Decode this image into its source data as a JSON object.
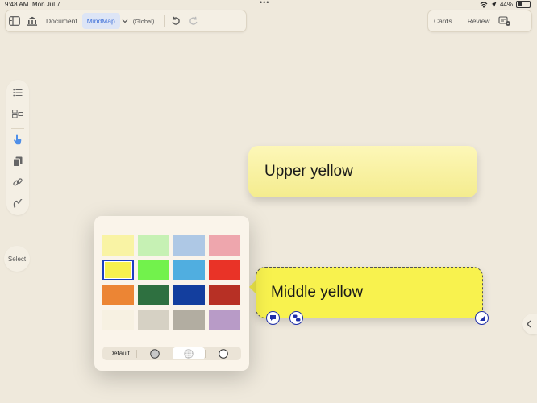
{
  "status": {
    "time": "9:48 AM",
    "date": "Mon Jul 7",
    "battery": "44%"
  },
  "toolbar_left": {
    "document_label": "Document",
    "mindmap_label": "MindMap",
    "scope_label": "(Global)..."
  },
  "toolbar_right": {
    "cards_label": "Cards",
    "review_label": "Review"
  },
  "side_panel": {
    "icons": [
      "list-icon",
      "layout-icon",
      "pointer-hand-icon",
      "copy-icon",
      "link-icon",
      "lasso-icon"
    ]
  },
  "select_label": "Select",
  "nodes": {
    "upper": "Upper yellow",
    "middle": "Middle yellow"
  },
  "palette": {
    "swatches": [
      "#f9f3a4",
      "#c6f1b4",
      "#aec8e5",
      "#eea6ad",
      "#f7f14e",
      "#72f24c",
      "#50aee0",
      "#e93327",
      "#ec8534",
      "#2e7040",
      "#133e9e",
      "#b73025",
      "#f7f1e2",
      "#d6d1c4",
      "#b2ada1",
      "#b89bc7"
    ],
    "selected_index": 4,
    "default_label": "Default"
  },
  "colors": {
    "accent": "#3d6fd8",
    "selection": "#1c3fc0",
    "background": "#efe9dc"
  }
}
